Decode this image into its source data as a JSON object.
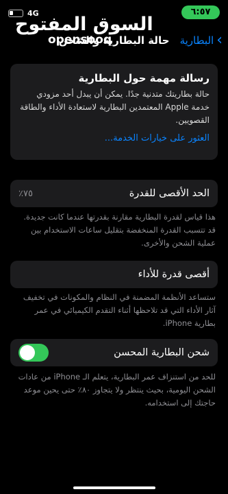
{
  "status_bar": {
    "time": "٦:٥٧",
    "network": "4G",
    "colors": {
      "time_pill": "#34c759"
    }
  },
  "watermark": {
    "arabic": "السوق المفتوح",
    "latin": "opensooq"
  },
  "nav": {
    "back_label": "البطارية",
    "title": "حالة البطارية والشحن"
  },
  "message": {
    "title": "رسالة مهمة حول البطارية",
    "body": "حالة بطاريتك متدنية جدًا. يمكن أن يبدل أحد مزودي خدمة Apple المعتمدين البطارية لاستعادة الأداء والطاقة القصويين.",
    "link": "العثور على خيارات الخدمة..."
  },
  "max_capacity": {
    "label": "الحد الأقصى للقدرة",
    "value": "٧٥٪",
    "footer": "هذا قياس لقدرة البطارية مقارنة بقدرتها عندما كانت جديدة. قد تتسبب القدرة المنخفضة بتقليل ساعات الاستخدام بين عملية الشحن والأخرى."
  },
  "peak_performance": {
    "label": "أقصى قدرة للأداء",
    "footer": "ستساعد الأنظمة المضمنة في النظام والمكونات في تخفيف آثار الأداء التي قد تلاحظها أثناء التقدم الكيميائي في عمر بطارية iPhone."
  },
  "optimized_charging": {
    "label": "شحن البطارية المحسن",
    "enabled": true,
    "footer": "للحد من استنزاف عمر البطارية، يتعلم الـ iPhone من عادات الشحن اليومية، بحيث ينتظر ولا يتجاوز ٨٠٪ حتى يحين موعد حاجتك إلى استخدامه."
  },
  "colors": {
    "accent": "#0a84ff",
    "toggle_on": "#34c759"
  }
}
